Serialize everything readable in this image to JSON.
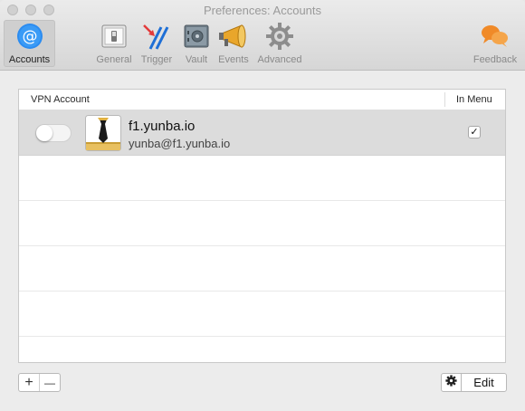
{
  "window": {
    "title": "Preferences: Accounts"
  },
  "toolbar": {
    "items": [
      {
        "label": "Accounts",
        "icon": "at-sign-icon",
        "selected": true
      },
      {
        "label": "General",
        "icon": "switch-icon"
      },
      {
        "label": "Trigger",
        "icon": "trigger-icon"
      },
      {
        "label": "Vault",
        "icon": "vault-icon"
      },
      {
        "label": "Events",
        "icon": "megaphone-icon"
      },
      {
        "label": "Advanced",
        "icon": "gear-icon"
      },
      {
        "label": "Feedback",
        "icon": "speech-bubbles-icon"
      }
    ]
  },
  "table": {
    "columns": {
      "account": "VPN Account",
      "in_menu": "In Menu"
    },
    "rows": [
      {
        "name": "f1.yunba.io",
        "email": "yunba@f1.yunba.io",
        "enabled": false,
        "in_menu": true,
        "check": "✓"
      }
    ]
  },
  "footer": {
    "add": "+",
    "remove": "—",
    "edit": "Edit"
  },
  "colors": {
    "accent": "#2c8cf0",
    "feedback": "#f08a28",
    "trigger_red": "#e33b3b"
  }
}
